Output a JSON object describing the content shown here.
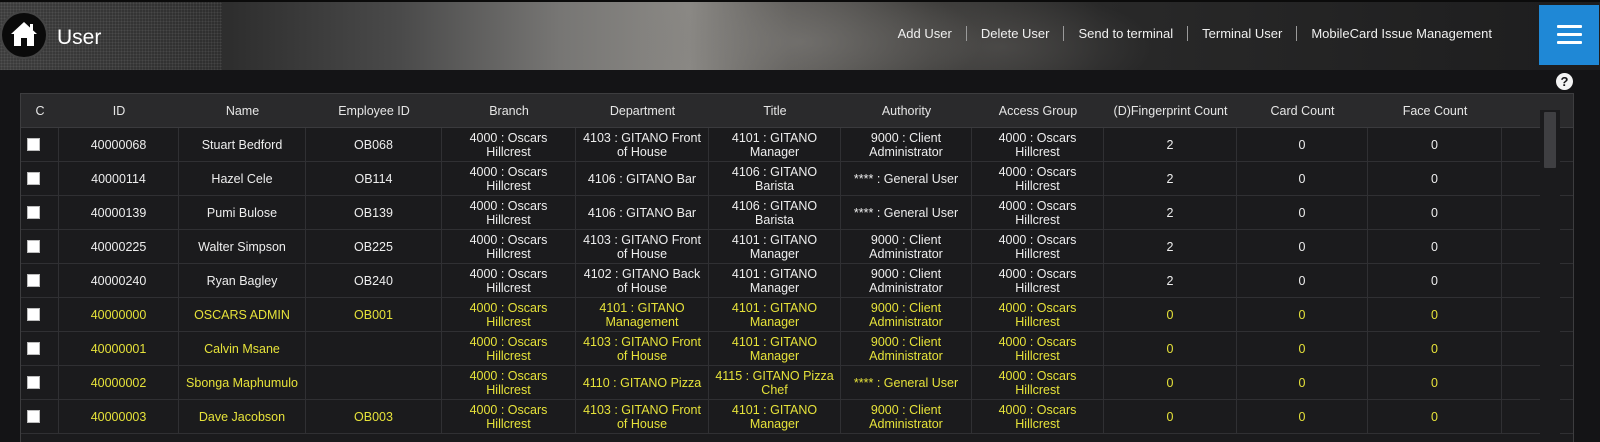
{
  "header": {
    "title": "User",
    "menu": [
      {
        "label": "Add User"
      },
      {
        "label": "Delete User"
      },
      {
        "label": "Send to terminal"
      },
      {
        "label": "Terminal User"
      },
      {
        "label": "MobileCard Issue Management"
      }
    ]
  },
  "help": {
    "label": "?"
  },
  "table": {
    "columns": [
      "C",
      "ID",
      "Name",
      "Employee ID",
      "Branch",
      "Department",
      "Title",
      "Authority",
      "Access Group",
      "(D)Fingerprint Count",
      "Card Count",
      "Face Count"
    ],
    "rows": [
      {
        "highlight": false,
        "id": "40000068",
        "name": "Stuart Bedford",
        "employee_id": "OB068",
        "branch": "4000 : Oscars Hillcrest",
        "department": "4103 : GITANO Front of House",
        "title": "4101 : GITANO Manager",
        "authority": "9000 : Client Administrator",
        "access_group": "4000 : Oscars Hillcrest",
        "fingerprint": "2",
        "card": "0",
        "face": "0"
      },
      {
        "highlight": false,
        "id": "40000114",
        "name": "Hazel Cele",
        "employee_id": "OB114",
        "branch": "4000 : Oscars Hillcrest",
        "department": "4106 : GITANO Bar",
        "title": "4106 : GITANO Barista",
        "authority": "**** : General User",
        "access_group": "4000 : Oscars Hillcrest",
        "fingerprint": "2",
        "card": "0",
        "face": "0"
      },
      {
        "highlight": false,
        "id": "40000139",
        "name": "Pumi Bulose",
        "employee_id": "OB139",
        "branch": "4000 : Oscars Hillcrest",
        "department": "4106 : GITANO Bar",
        "title": "4106 : GITANO Barista",
        "authority": "**** : General User",
        "access_group": "4000 : Oscars Hillcrest",
        "fingerprint": "2",
        "card": "0",
        "face": "0"
      },
      {
        "highlight": false,
        "id": "40000225",
        "name": "Walter Simpson",
        "employee_id": "OB225",
        "branch": "4000 : Oscars Hillcrest",
        "department": "4103 : GITANO Front of House",
        "title": "4101 : GITANO Manager",
        "authority": "9000 : Client Administrator",
        "access_group": "4000 : Oscars Hillcrest",
        "fingerprint": "2",
        "card": "0",
        "face": "0"
      },
      {
        "highlight": false,
        "id": "40000240",
        "name": "Ryan Bagley",
        "employee_id": "OB240",
        "branch": "4000 : Oscars Hillcrest",
        "department": "4102 : GITANO Back of House",
        "title": "4101 : GITANO Manager",
        "authority": "9000 : Client Administrator",
        "access_group": "4000 : Oscars Hillcrest",
        "fingerprint": "2",
        "card": "0",
        "face": "0"
      },
      {
        "highlight": true,
        "id": "40000000",
        "name": "OSCARS ADMIN",
        "employee_id": "OB001",
        "branch": "4000 : Oscars Hillcrest",
        "department": "4101 : GITANO Management",
        "title": "4101 : GITANO Manager",
        "authority": "9000 : Client Administrator",
        "access_group": "4000 : Oscars Hillcrest",
        "fingerprint": "0",
        "card": "0",
        "face": "0"
      },
      {
        "highlight": true,
        "id": "40000001",
        "name": "Calvin Msane",
        "employee_id": "",
        "branch": "4000 : Oscars Hillcrest",
        "department": "4103 : GITANO Front of House",
        "title": "4101 : GITANO Manager",
        "authority": "9000 : Client Administrator",
        "access_group": "4000 : Oscars Hillcrest",
        "fingerprint": "0",
        "card": "0",
        "face": "0"
      },
      {
        "highlight": true,
        "id": "40000002",
        "name": "Sbonga Maphumulo",
        "employee_id": "",
        "branch": "4000 : Oscars Hillcrest",
        "department": "4110 : GITANO Pizza",
        "title": "4115 : GITANO Pizza Chef",
        "authority": "**** : General User",
        "access_group": "4000 : Oscars Hillcrest",
        "fingerprint": "0",
        "card": "0",
        "face": "0"
      },
      {
        "highlight": true,
        "id": "40000003",
        "name": "Dave Jacobson",
        "employee_id": "OB003",
        "branch": "4000 : Oscars Hillcrest",
        "department": "4103 : GITANO Front of House",
        "title": "4101 : GITANO Manager",
        "authority": "9000 : Client Administrator",
        "access_group": "4000 : Oscars Hillcrest",
        "fingerprint": "0",
        "card": "0",
        "face": "0"
      }
    ]
  }
}
